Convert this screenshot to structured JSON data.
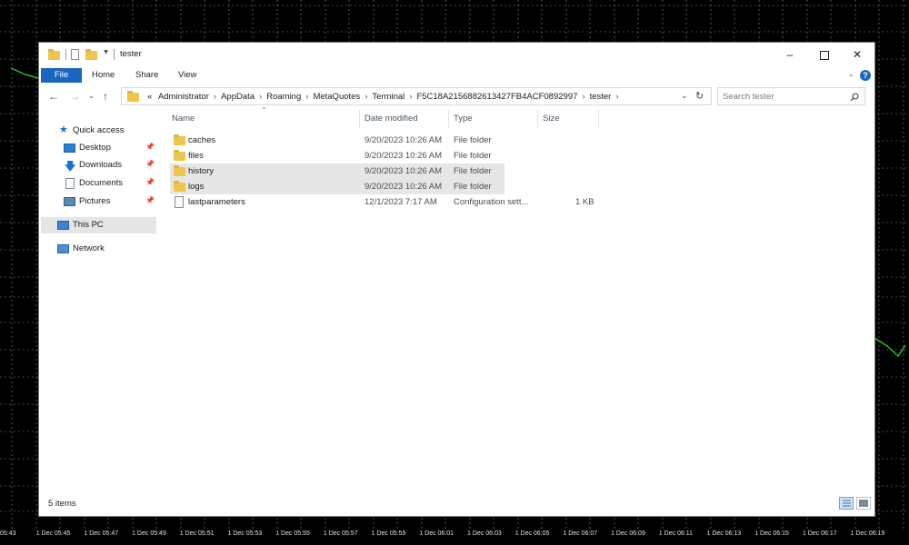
{
  "background": {
    "chart_colors": {
      "background": "#000000",
      "grid": "#8a8a8a",
      "line": "#22c02a",
      "axis_text": "#e0e0e0"
    },
    "time_axis_labels": [
      "05:43",
      "1 Dec 05:45",
      "1 Dec 05:47",
      "1 Dec 05:49",
      "1 Dec 05:51",
      "1 Dec 05:53",
      "1 Dec 05:55",
      "1 Dec 05:57",
      "1 Dec 05:59",
      "1 Dec 06:01",
      "1 Dec 06:03",
      "1 Dec 06:05",
      "1 Dec 06:07",
      "1 Dec 06:09",
      "1 Dec 06:11",
      "1 Dec 06:13",
      "1 Dec 06:15",
      "1 Dec 06:17",
      "1 Dec 06:19"
    ]
  },
  "window": {
    "title": "tester",
    "controls": {
      "minimize_icon": "minimize-icon",
      "maximize_icon": "maximize-icon",
      "close_icon": "close-icon"
    },
    "ribbon": {
      "tabs": [
        {
          "label": "File",
          "active": true
        },
        {
          "label": "Home"
        },
        {
          "label": "Share"
        },
        {
          "label": "View"
        }
      ],
      "accent_color": "#1a65c2"
    },
    "address_bar": {
      "overflow": "«",
      "path": [
        "Administrator",
        "AppData",
        "Roaming",
        "MetaQuotes",
        "Terminal",
        "F5C18A2156882613427FB4ACF0892997",
        "tester"
      ],
      "separator": "›"
    },
    "search": {
      "placeholder": "Search tester"
    },
    "nav_pane": {
      "quick_access": {
        "label": "Quick access",
        "icon": "star-icon"
      },
      "pinned": [
        {
          "label": "Desktop",
          "icon": "desktop-icon"
        },
        {
          "label": "Downloads",
          "icon": "download-arrow-icon"
        },
        {
          "label": "Documents",
          "icon": "document-icon"
        },
        {
          "label": "Pictures",
          "icon": "picture-icon"
        }
      ],
      "this_pc": {
        "label": "This PC",
        "icon": "computer-icon",
        "selected": true
      },
      "network": {
        "label": "Network",
        "icon": "network-icon"
      }
    },
    "file_list": {
      "columns": {
        "name": "Name",
        "date_modified": "Date modified",
        "type": "Type",
        "size": "Size"
      },
      "rows": [
        {
          "name": "caches",
          "date": "9/20/2023 10:26 AM",
          "type": "File folder",
          "size": "",
          "icon": "folder-icon",
          "highlighted": false
        },
        {
          "name": "files",
          "date": "9/20/2023 10:26 AM",
          "type": "File folder",
          "size": "",
          "icon": "folder-icon",
          "highlighted": false
        },
        {
          "name": "history",
          "date": "9/20/2023 10:26 AM",
          "type": "File folder",
          "size": "",
          "icon": "folder-icon",
          "highlighted": true
        },
        {
          "name": "logs",
          "date": "9/20/2023 10:26 AM",
          "type": "File folder",
          "size": "",
          "icon": "folder-icon",
          "highlighted": true
        },
        {
          "name": "lastparameters",
          "date": "12/1/2023 7:17 AM",
          "type": "Configuration sett...",
          "size": "1 KB",
          "icon": "config-file-icon",
          "highlighted": false
        }
      ]
    },
    "status_bar": {
      "item_count": "5 items"
    }
  }
}
